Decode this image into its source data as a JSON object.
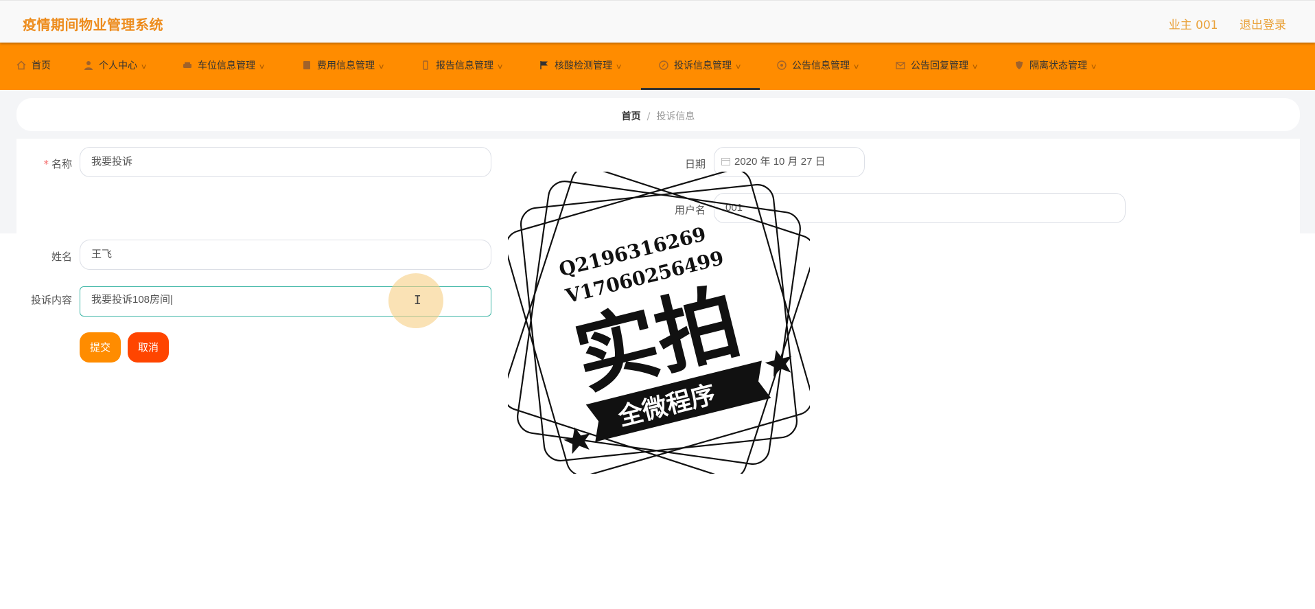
{
  "app": {
    "title": "疫情期间物业管理系统"
  },
  "user": {
    "name": "业主 001",
    "logout": "退出登录"
  },
  "nav": [
    {
      "label": "首页",
      "icon": "home-icon"
    },
    {
      "label": "个人中心",
      "icon": "user-icon"
    },
    {
      "label": "车位信息管理",
      "icon": "car-icon"
    },
    {
      "label": "费用信息管理",
      "icon": "bill-icon"
    },
    {
      "label": "报告信息管理",
      "icon": "report-icon"
    },
    {
      "label": "核酸检测管理",
      "icon": "flag-icon"
    },
    {
      "label": "投诉信息管理",
      "icon": "complaint-icon",
      "active": true
    },
    {
      "label": "公告信息管理",
      "icon": "notice-icon"
    },
    {
      "label": "公告回复管理",
      "icon": "mail-icon"
    },
    {
      "label": "隔离状态管理",
      "icon": "shield-icon"
    }
  ],
  "breadcrumb": {
    "home": "首页",
    "separator": "/",
    "current": "投诉信息"
  },
  "form": {
    "name_label": "名称",
    "name_value": "我要投诉",
    "date_label": "日期",
    "date_value": "2020 年 10 月 27 日",
    "user_label": "用户名",
    "user_value": "001",
    "person_label": "姓名",
    "person_value": "王飞",
    "content_label": "投诉内容",
    "content_value": "我要投诉108房间",
    "submit": "提交",
    "cancel": "取消"
  },
  "watermark": {
    "qq": "Q2196316269",
    "wechat": "V17060256499",
    "main": "实拍",
    "banner": "全微程序"
  },
  "colors": {
    "brand": "#ed8c1d",
    "nav_bg": "#ff8c00",
    "submit": "#ff8c00",
    "cancel": "#ff4500",
    "focus": "#3cb5a5"
  }
}
